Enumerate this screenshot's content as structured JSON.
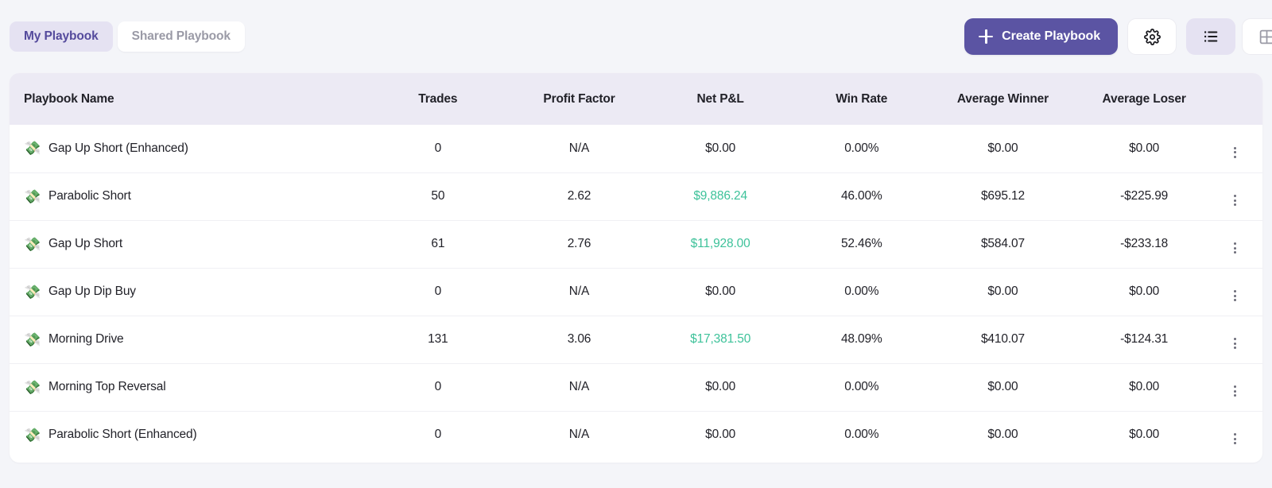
{
  "theme": {
    "page_background": "#f4f5f9",
    "accent_purple": "#5b54a3",
    "accent_purple_soft": "#e5e2f2",
    "positive_green": "#3ec29a",
    "header_row_background": "#eceaf4",
    "text_primary": "#222229",
    "text_muted": "#9a9aa6"
  },
  "toolbar": {
    "tabs": [
      {
        "label": "My Playbook",
        "active": true
      },
      {
        "label": "Shared Playbook",
        "active": false
      }
    ],
    "create_button": {
      "label": "Create Playbook",
      "icon": "plus-icon"
    },
    "settings_button": {
      "icon": "gear-icon"
    },
    "view_toggle": [
      {
        "icon": "list-view-icon",
        "active": true
      },
      {
        "icon": "grid-view-icon",
        "active": false
      }
    ]
  },
  "table": {
    "columns": [
      "Playbook Name",
      "Trades",
      "Profit Factor",
      "Net P&L",
      "Win Rate",
      "Average Winner",
      "Average Loser"
    ],
    "row_icon": "💸",
    "row_menu_icon": "kebab-menu-icon",
    "rows": [
      {
        "name": "Gap Up Short (Enhanced)",
        "trades": "0",
        "profit_factor": "N/A",
        "net_pl": "$0.00",
        "net_pl_positive": false,
        "win_rate": "0.00%",
        "average_winner": "$0.00",
        "average_loser": "$0.00"
      },
      {
        "name": "Parabolic Short",
        "trades": "50",
        "profit_factor": "2.62",
        "net_pl": "$9,886.24",
        "net_pl_positive": true,
        "win_rate": "46.00%",
        "average_winner": "$695.12",
        "average_loser": "-$225.99"
      },
      {
        "name": "Gap Up Short",
        "trades": "61",
        "profit_factor": "2.76",
        "net_pl": "$11,928.00",
        "net_pl_positive": true,
        "win_rate": "52.46%",
        "average_winner": "$584.07",
        "average_loser": "-$233.18"
      },
      {
        "name": "Gap Up Dip Buy",
        "trades": "0",
        "profit_factor": "N/A",
        "net_pl": "$0.00",
        "net_pl_positive": false,
        "win_rate": "0.00%",
        "average_winner": "$0.00",
        "average_loser": "$0.00"
      },
      {
        "name": "Morning Drive",
        "trades": "131",
        "profit_factor": "3.06",
        "net_pl": "$17,381.50",
        "net_pl_positive": true,
        "win_rate": "48.09%",
        "average_winner": "$410.07",
        "average_loser": "-$124.31"
      },
      {
        "name": "Morning Top Reversal",
        "trades": "0",
        "profit_factor": "N/A",
        "net_pl": "$0.00",
        "net_pl_positive": false,
        "win_rate": "0.00%",
        "average_winner": "$0.00",
        "average_loser": "$0.00"
      },
      {
        "name": "Parabolic Short (Enhanced)",
        "trades": "0",
        "profit_factor": "N/A",
        "net_pl": "$0.00",
        "net_pl_positive": false,
        "win_rate": "0.00%",
        "average_winner": "$0.00",
        "average_loser": "$0.00"
      }
    ]
  }
}
